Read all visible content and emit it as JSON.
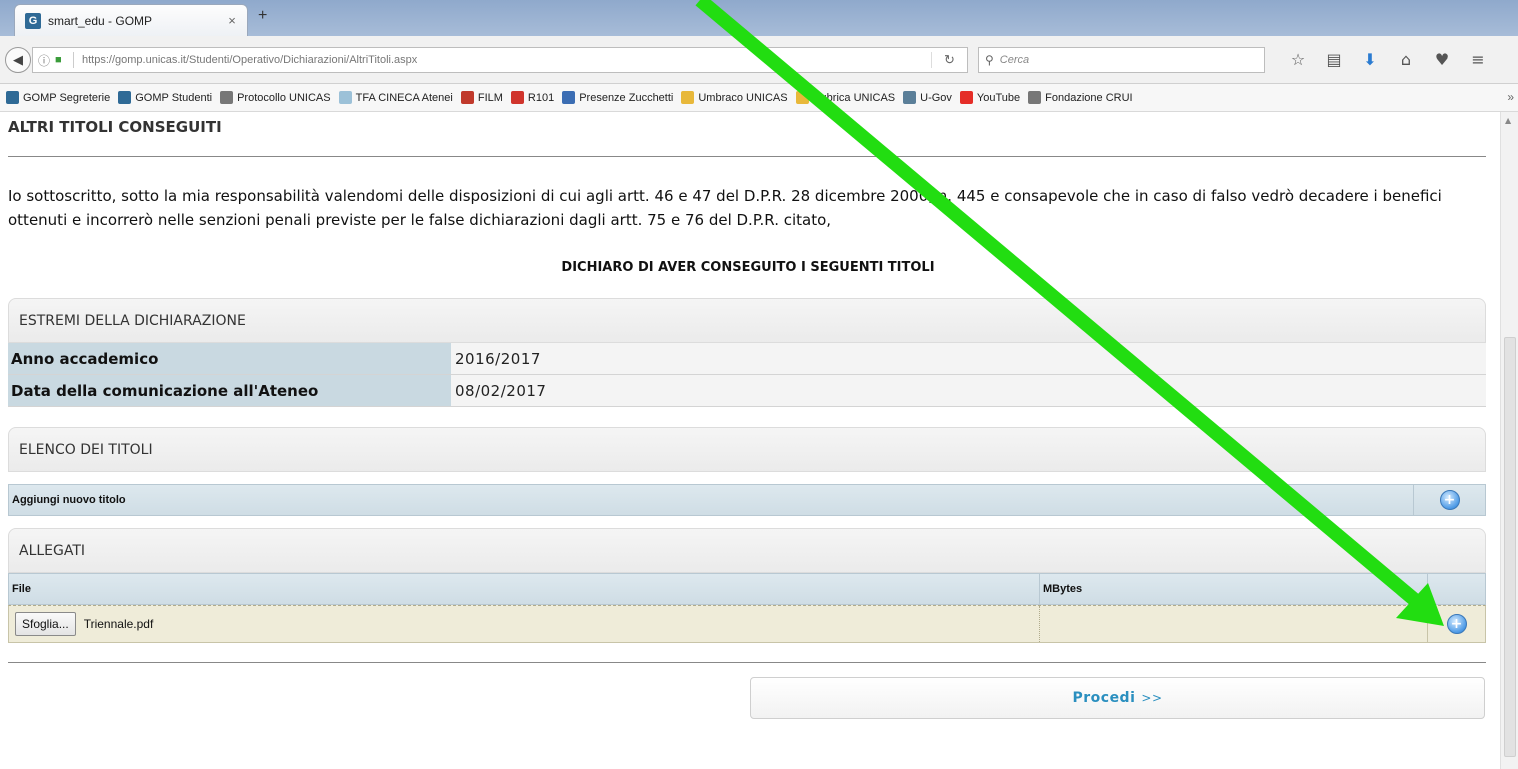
{
  "browser": {
    "tab_title": "smart_edu - GOMP",
    "tab_close": "×",
    "new_tab": "+",
    "url": "https://gomp.unicas.it/Studenti/Operativo/Dichiarazioni/AltriTitoli.aspx",
    "search_placeholder": "Cerca",
    "icons": [
      "back-icon",
      "info-icon",
      "lock-icon",
      "reload-icon",
      "search-icon",
      "star-icon",
      "reading-list-icon",
      "download-icon",
      "home-icon",
      "pocket-icon",
      "menu-icon"
    ]
  },
  "bookmarks": [
    {
      "label": "GOMP Segreterie",
      "color": "#2f6a96"
    },
    {
      "label": "GOMP Studenti",
      "color": "#2f6a96"
    },
    {
      "label": "Protocollo UNICAS",
      "color": "#777777"
    },
    {
      "label": "TFA CINECA Atenei",
      "color": "#9cc1d8"
    },
    {
      "label": "FILM",
      "color": "#c0392b"
    },
    {
      "label": "R101",
      "color": "#d0342c"
    },
    {
      "label": "Presenze Zucchetti",
      "color": "#3b6db3"
    },
    {
      "label": "Umbraco UNICAS",
      "color": "#e8b83a"
    },
    {
      "label": "Rubrica UNICAS",
      "color": "#e8b83a"
    },
    {
      "label": "U-Gov",
      "color": "#5b7f99"
    },
    {
      "label": "YouTube",
      "color": "#e52d27"
    },
    {
      "label": "Fondazione CRUI",
      "color": "#777777"
    }
  ],
  "bookmarks_more": "»",
  "page": {
    "section_title": "ALTRI TITOLI CONSEGUITI",
    "paragraph": "Io sottoscritto, sotto la mia responsabilità valendomi delle disposizioni di cui agli artt. 46 e 47 del D.P.R. 28 dicembre 2000, n. 445 e consapevole che in caso di falso vedrò decadere i benefici ottenuti e incorrerò nelle senzioni penali previste per le false dichiarazioni dagli artt. 75 e 76 del D.P.R. citato,",
    "declaration": "DICHIARO DI AVER CONSEGUITO I SEGUENTI TITOLI",
    "estremi": {
      "header": "ESTREMI DELLA DICHIARAZIONE",
      "anno_label": "Anno accademico",
      "anno_value": "2016/2017",
      "data_label": "Data della comunicazione all'Ateneo",
      "data_value": "08/02/2017"
    },
    "titoli": {
      "header": "ELENCO DEI TITOLI",
      "add_label": "Aggiungi nuovo titolo"
    },
    "allegati": {
      "header": "ALLEGATI",
      "col_file": "File",
      "col_mbytes": "MBytes",
      "browse_label": "Sfoglia...",
      "file_name": "Triennale.pdf"
    },
    "proceed_label": "Procedi",
    "proceed_arrows": ">>"
  },
  "annotation": {
    "arrow_color": "#22dd11"
  }
}
